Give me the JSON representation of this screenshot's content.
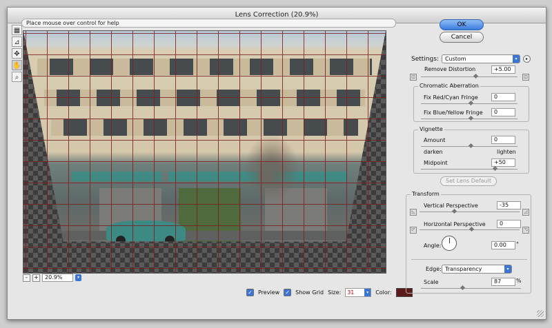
{
  "window": {
    "title": "Lens Correction (20.9%)"
  },
  "help": {
    "text": "Place mouse over control for help"
  },
  "tools": [
    {
      "name": "remove-distortion-tool-icon",
      "glyph": "▦"
    },
    {
      "name": "straighten-tool-icon",
      "glyph": "⊿"
    },
    {
      "name": "move-grid-tool-icon",
      "glyph": "✥"
    },
    {
      "name": "hand-tool-icon",
      "glyph": "✋"
    },
    {
      "name": "zoom-tool-icon",
      "glyph": "🔍"
    }
  ],
  "buttons": {
    "ok": "OK",
    "cancel": "Cancel",
    "set_lens_default": "Set Lens Default"
  },
  "settings": {
    "label": "Settings:",
    "value": "Custom"
  },
  "remove_distortion": {
    "label": "Remove Distortion",
    "value": "+5.00",
    "level": 0.55
  },
  "chromatic": {
    "title": "Chromatic Aberration",
    "red_cyan": {
      "label": "Fix Red/Cyan Fringe",
      "value": "0",
      "level": 0.5
    },
    "blue_yellow": {
      "label": "Fix Blue/Yellow Fringe",
      "value": "0",
      "level": 0.5
    }
  },
  "vignette": {
    "title": "Vignette",
    "amount": {
      "label": "Amount",
      "value": "0",
      "level": 0.5
    },
    "darken": "darken",
    "lighten": "lighten",
    "midpoint": {
      "label": "Midpoint",
      "value": "+50",
      "level": 0.75
    }
  },
  "transform": {
    "title": "Transform",
    "vertical": {
      "label": "Vertical Perspective",
      "value": "-35",
      "level": 0.33
    },
    "horizontal": {
      "label": "Horizontal Perspective",
      "value": "0",
      "level": 0.5
    },
    "angle": {
      "label": "Angle:",
      "value": "0.00",
      "unit": "°"
    },
    "edge": {
      "label": "Edge:",
      "value": "Transparency"
    },
    "scale": {
      "label": "Scale",
      "value": "87",
      "unit": "%",
      "level": 0.4
    }
  },
  "zoom": {
    "minus": "-",
    "plus": "+",
    "value": "20.9%"
  },
  "options": {
    "preview": "Preview",
    "preview_checked": true,
    "show_grid": "Show Grid",
    "show_grid_checked": true,
    "size_label": "Size:",
    "size_value": "31",
    "color_label": "Color:",
    "grid_color": "#5c1a1a"
  }
}
